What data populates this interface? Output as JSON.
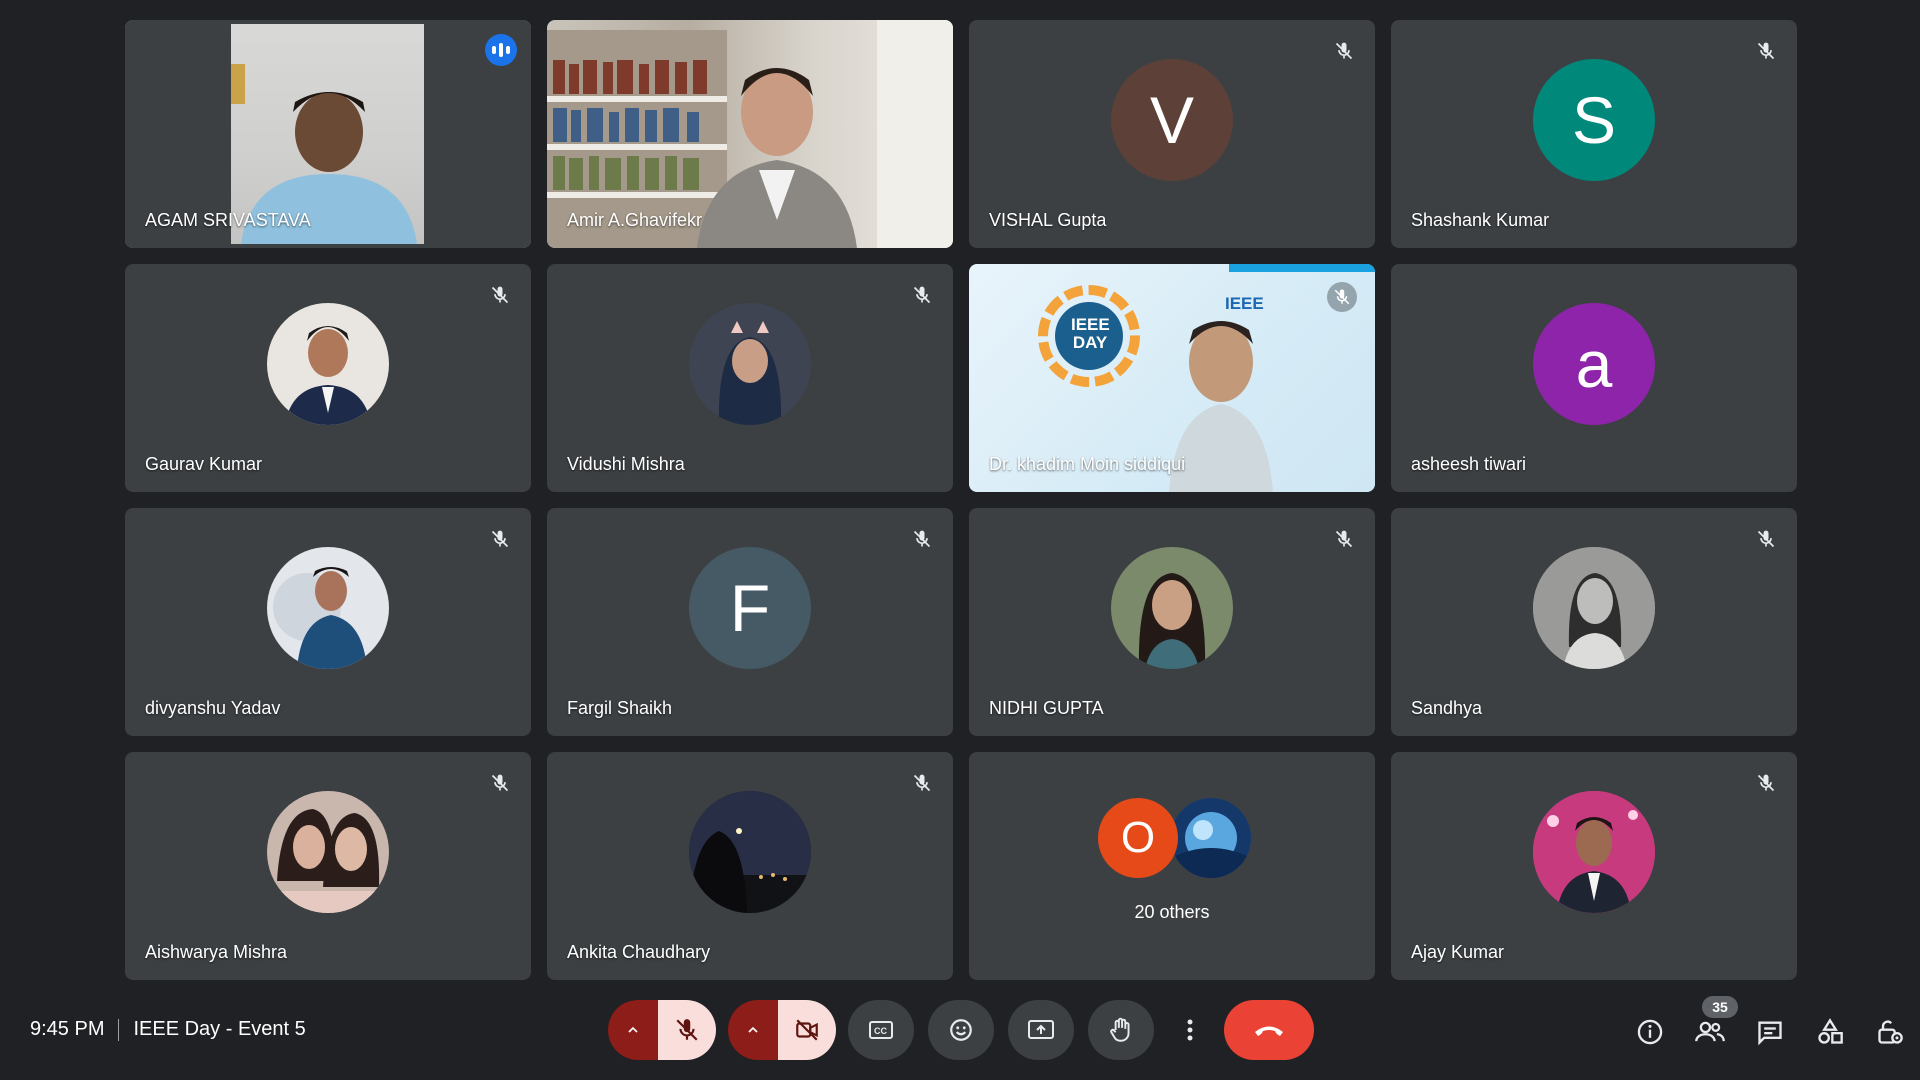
{
  "participants": [
    {
      "name": "AGAM SRIVASTAVA",
      "type": "video",
      "status": "speaking"
    },
    {
      "name": "Amir A.Ghavifekr",
      "type": "video",
      "status": "none"
    },
    {
      "name": "VISHAL Gupta",
      "type": "initial",
      "initial": "V",
      "color": "#5d4037",
      "status": "muted"
    },
    {
      "name": "Shashank Kumar",
      "type": "initial",
      "initial": "S",
      "color": "#00897b",
      "status": "muted"
    },
    {
      "name": "Gaurav Kumar",
      "type": "photo",
      "status": "muted"
    },
    {
      "name": "Vidushi Mishra",
      "type": "photo",
      "status": "muted"
    },
    {
      "name": "Dr. khadim Moin siddiqui",
      "type": "video",
      "status": "muted"
    },
    {
      "name": "asheesh tiwari",
      "type": "initial",
      "initial": "a",
      "color": "#8e24aa",
      "status": "none"
    },
    {
      "name": "divyanshu Yadav",
      "type": "photo",
      "status": "muted"
    },
    {
      "name": "Fargil Shaikh",
      "type": "initial",
      "initial": "F",
      "color": "#455a64",
      "status": "muted"
    },
    {
      "name": "NIDHI GUPTA",
      "type": "photo",
      "status": "muted"
    },
    {
      "name": "Sandhya",
      "type": "photo",
      "status": "muted"
    },
    {
      "name": "Aishwarya Mishra",
      "type": "photo",
      "status": "muted"
    },
    {
      "name": "Ankita Chaudhary",
      "type": "photo",
      "status": "muted"
    },
    {
      "name": "Ajay Kumar",
      "type": "photo",
      "status": "muted"
    }
  ],
  "others_tile": {
    "label": "20 others",
    "initial": "O",
    "color": "#e64a19"
  },
  "khadim_overlay": {
    "logo_text": "IEEE",
    "badge_line1": "IEEE",
    "badge_line2": "DAY"
  },
  "meeting": {
    "time": "9:45 PM",
    "title": "IEEE Day - Event 5"
  },
  "people_count": "35",
  "colors": {
    "background": "#202124",
    "tile": "#3c4043",
    "accent": "#8ab4f8",
    "end_call": "#ea4335",
    "muted_red": "#8c1d18"
  },
  "icons": {
    "mic": "mic-off-icon",
    "camera": "camera-off-icon",
    "captions": "captions-icon",
    "reactions": "emoji-icon",
    "present": "present-icon",
    "hand": "raise-hand-icon",
    "more": "more-vert-icon",
    "end": "end-call-icon",
    "info": "info-icon",
    "people": "people-icon",
    "chat": "chat-icon",
    "activities": "activities-icon",
    "host": "host-controls-icon"
  }
}
